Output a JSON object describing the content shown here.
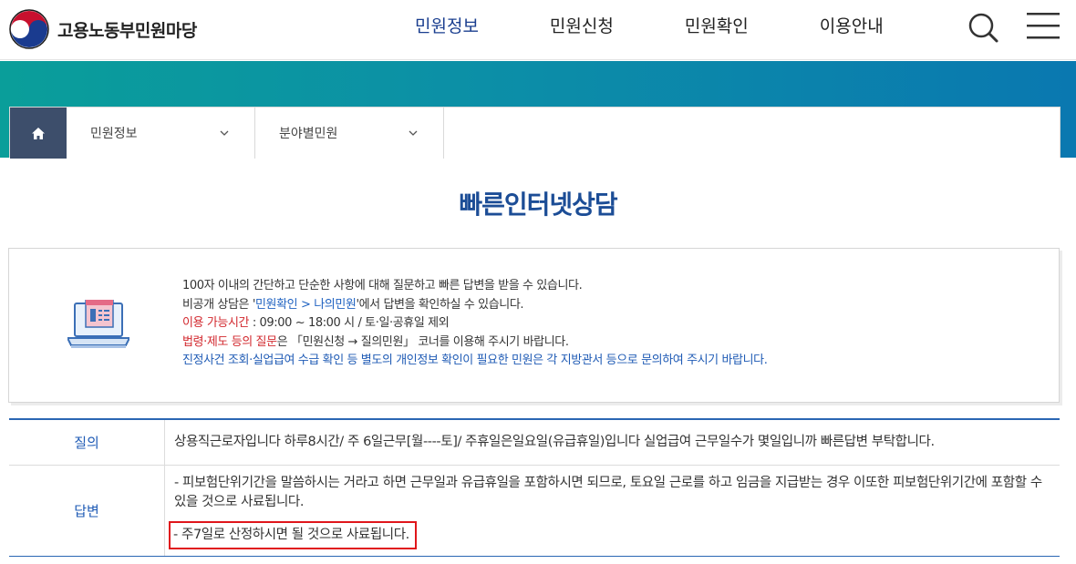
{
  "header": {
    "logo_text": "고용노동부민원마당",
    "nav": [
      {
        "label": "민원정보",
        "active": true
      },
      {
        "label": "민원신청",
        "active": false
      },
      {
        "label": "민원확인",
        "active": false
      },
      {
        "label": "이용안내",
        "active": false
      }
    ],
    "search_icon": "search-icon",
    "menu_icon": "hamburger-menu-icon"
  },
  "breadcrumb": {
    "home_icon": "home-icon",
    "level1": "민원정보",
    "level2": "분야별민원"
  },
  "page": {
    "title": "빠른인터넷상담"
  },
  "info": {
    "line1": "100자 이내의 간단하고 단순한 사항에 대해 질문하고 빠른 답변을 받을 수 있습니다.",
    "line2_prefix": "비공개 상담은 '",
    "line2_link": "민원확인 > 나의민원",
    "line2_suffix": "'에서 답변을 확인하실 수 있습니다.",
    "line3_label": "이용 가능시간",
    "line3_text": " : 09:00 ~ 18:00 시 / 토·일·공휴일 제외",
    "line4_label": "법령·제도 등의 질문",
    "line4_text": "은 「민원신청 → 질의민원」 코너를 이용해 주시기 바랍니다.",
    "line5": "진정사건 조회·실업급여 수급 확인 등 별도의 개인정보 확인이 필요한 민원은 각 지방관서 등으로 문의하여 주시기 바랍니다."
  },
  "qa": {
    "question_label": "질의",
    "question_text": "상용직근로자입니다 하루8시간/ 주 6일근무[월----토]/ 주휴일은일요일(유급휴일)입니다 실업급여 근무일수가 몇일입니까 빠른답변 부탁합니다.",
    "answer_label": "답변",
    "answer_line1": "- 피보험단위기간을 말씀하시는 거라고 하면 근무일과 유급휴일을 포함하시면 되므로, 토요일 근로를 하고 임금을 지급받는 경우 이또한 피보험단위기간에 포함할 수 있을 것으로 사료됩니다.",
    "answer_line2": "- 주7일로 산정하시면 될 것으로 사료됩니다."
  },
  "colors": {
    "brand_blue": "#1c4d96",
    "banner_start": "#0a9e9a",
    "banner_end": "#0a78b0",
    "highlight_red": "#e0161b"
  }
}
